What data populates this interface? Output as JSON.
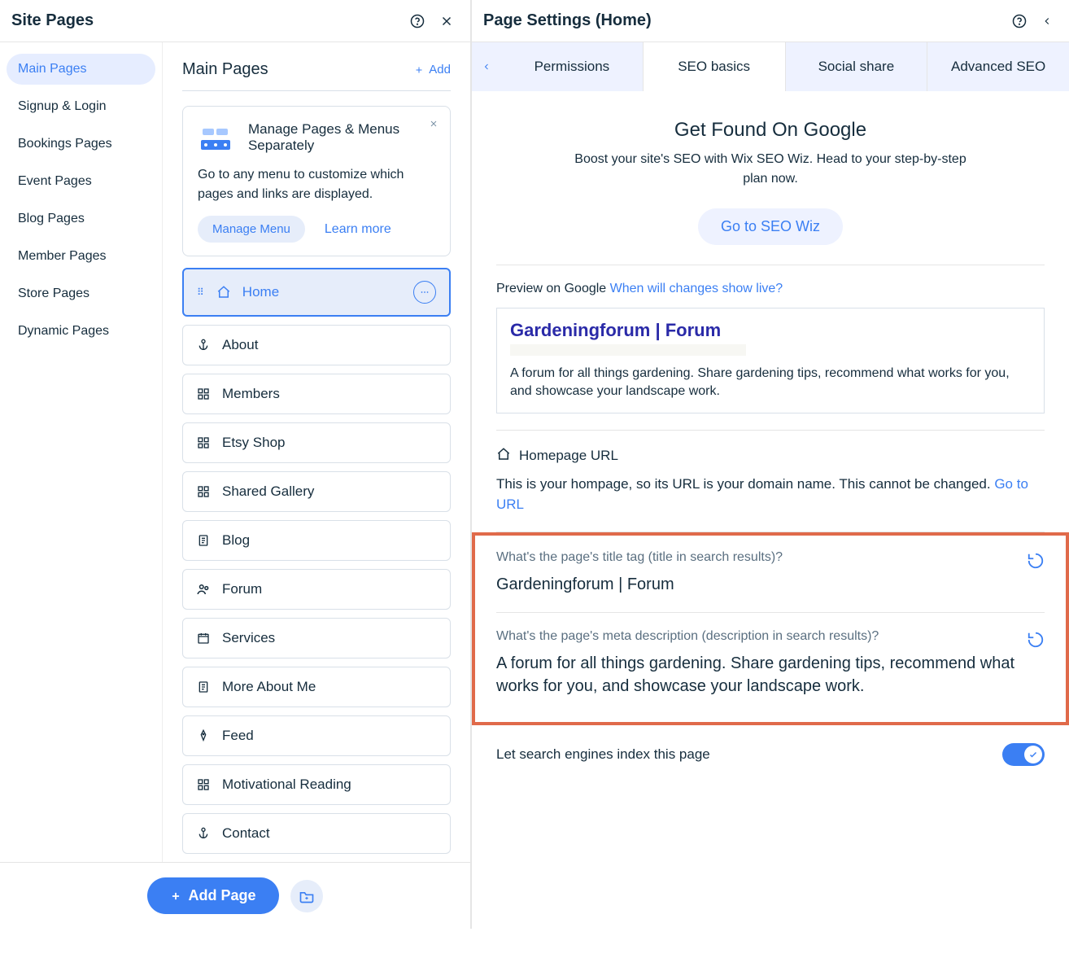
{
  "leftHeader": {
    "title": "Site Pages"
  },
  "categories": [
    "Main Pages",
    "Signup & Login",
    "Bookings Pages",
    "Event Pages",
    "Blog Pages",
    "Member Pages",
    "Store Pages",
    "Dynamic Pages"
  ],
  "pagesCol": {
    "header": "Main Pages",
    "add": "Add",
    "info": {
      "title": "Manage Pages & Menus Separately",
      "desc": "Go to any menu to customize which pages and links are displayed.",
      "manage": "Manage Menu",
      "learn": "Learn more"
    },
    "pages": [
      {
        "label": "Home",
        "icon": "home",
        "active": true
      },
      {
        "label": "About",
        "icon": "anchor"
      },
      {
        "label": "Members",
        "icon": "grid"
      },
      {
        "label": "Etsy Shop",
        "icon": "grid"
      },
      {
        "label": "Shared Gallery",
        "icon": "grid"
      },
      {
        "label": "Blog",
        "icon": "doc"
      },
      {
        "label": "Forum",
        "icon": "people"
      },
      {
        "label": "Services",
        "icon": "calendar"
      },
      {
        "label": "More About Me",
        "icon": "doc"
      },
      {
        "label": "Feed",
        "icon": "pen"
      },
      {
        "label": "Motivational Reading",
        "icon": "grid"
      },
      {
        "label": "Contact",
        "icon": "anchor"
      }
    ],
    "addPage": "Add Page"
  },
  "rightHeader": {
    "title": "Page Settings (Home)"
  },
  "tabs": [
    "Permissions",
    "SEO basics",
    "Social share",
    "Advanced SEO"
  ],
  "seo": {
    "heroTitle": "Get Found On Google",
    "heroDesc": "Boost your site's SEO with Wix SEO Wiz. Head to your step-by-step plan now.",
    "wizBtn": "Go to SEO Wiz",
    "previewLabel": "Preview on Google",
    "previewLink": "When will changes show live?",
    "preview": {
      "title": "Gardeningforum | Forum",
      "desc": "A forum for all things gardening. Share gardening tips, recommend what works for you, and showcase your landscape work."
    },
    "urlLabel": "Homepage URL",
    "urlDesc1": "This is your hompage, so its URL is your domain name. This cannot be changed.",
    "urlDesc2": "Go to URL",
    "titleTag": {
      "label": "What's the page's title tag (title in search results)?",
      "value": "Gardeningforum | Forum"
    },
    "metaDesc": {
      "label": "What's the page's meta description (description in search results)?",
      "value": "A forum for all things gardening. Share gardening tips, recommend what works for you, and showcase your landscape work."
    },
    "indexLabel": "Let search engines index this page"
  }
}
